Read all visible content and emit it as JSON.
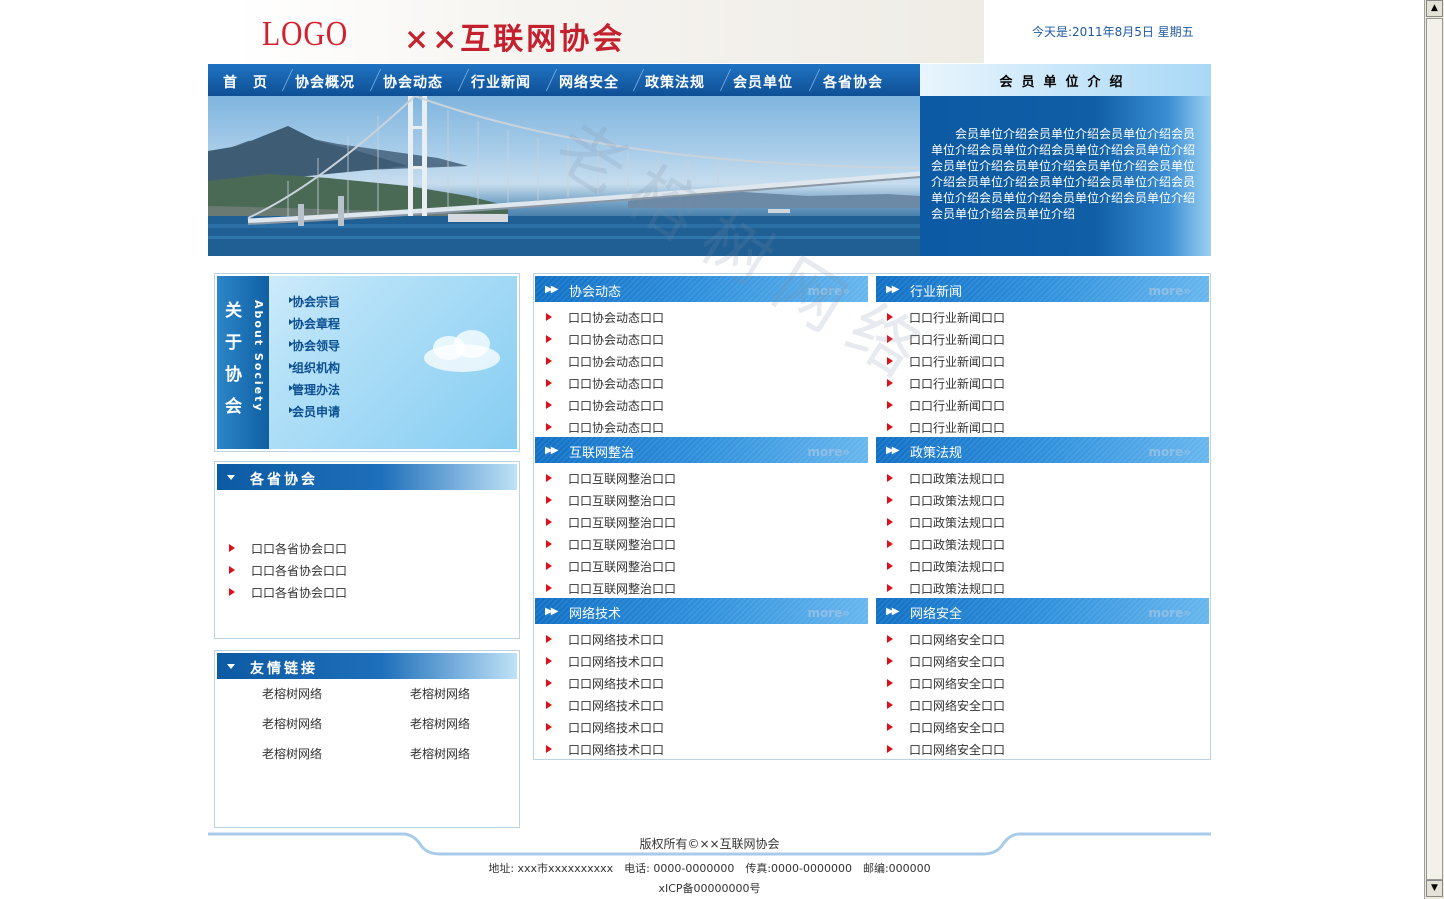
{
  "header": {
    "logo": "LOGO",
    "org_title": "××互联网协会",
    "date": "今天是:2011年8月5日 星期五"
  },
  "nav": [
    "首　页",
    "协会概况",
    "协会动态",
    "行业新闻",
    "网络安全",
    "政策法规",
    "会员单位",
    "各省协会"
  ],
  "member": {
    "title": "会员单位介绍",
    "text": "会员单位介绍会员单位介绍会员单位介绍会员单位介绍会员单位介绍会员单位介绍会员单位介绍会员单位介绍会员单位介绍会员单位介绍会员单位介绍会员单位介绍会员单位介绍会员单位介绍会员单位介绍会员单位介绍会员单位介绍会员单位介绍会员单位介绍会员单位介绍"
  },
  "about": {
    "title_cn": [
      "关",
      "于",
      "协",
      "会"
    ],
    "title_en": "About Society",
    "links": [
      "协会宗旨",
      "协会章程",
      "协会领导",
      "组织机构",
      "管理办法",
      "会员申请"
    ]
  },
  "provinces": {
    "title": "各省协会",
    "items": [
      "口口各省协会口口",
      "口口各省协会口口",
      "口口各省协会口口"
    ]
  },
  "friends": {
    "title": "友情链接",
    "links": [
      "老榕树网络",
      "老榕树网络",
      "老榕树网络",
      "老榕树网络",
      "老榕树网络",
      "老榕树网络"
    ]
  },
  "sections": [
    {
      "title": "协会动态",
      "more": "more»",
      "items": [
        "口口协会动态口口",
        "口口协会动态口口",
        "口口协会动态口口",
        "口口协会动态口口",
        "口口协会动态口口",
        "口口协会动态口口"
      ]
    },
    {
      "title": "行业新闻",
      "more": "more»",
      "items": [
        "口口行业新闻口口",
        "口口行业新闻口口",
        "口口行业新闻口口",
        "口口行业新闻口口",
        "口口行业新闻口口",
        "口口行业新闻口口"
      ]
    },
    {
      "title": "互联网整治",
      "more": "more»",
      "items": [
        "口口互联网整治口口",
        "口口互联网整治口口",
        "口口互联网整治口口",
        "口口互联网整治口口",
        "口口互联网整治口口",
        "口口互联网整治口口"
      ]
    },
    {
      "title": "政策法规",
      "more": "more»",
      "items": [
        "口口政策法规口口",
        "口口政策法规口口",
        "口口政策法规口口",
        "口口政策法规口口",
        "口口政策法规口口",
        "口口政策法规口口"
      ]
    },
    {
      "title": "网络技术",
      "more": "more»",
      "items": [
        "口口网络技术口口",
        "口口网络技术口口",
        "口口网络技术口口",
        "口口网络技术口口",
        "口口网络技术口口",
        "口口网络技术口口"
      ]
    },
    {
      "title": "网络安全",
      "more": "more»",
      "items": [
        "口口网络安全口口",
        "口口网络安全口口",
        "口口网络安全口口",
        "口口网络安全口口",
        "口口网络安全口口",
        "口口网络安全口口"
      ]
    }
  ],
  "footer": {
    "copyright": "版权所有©××互联网协会",
    "address": "地址: xxx市xxxxxxxxxx　电话: 0000-0000000　传真:0000-0000000　邮编:000000",
    "icp": "xICP备00000000号"
  },
  "watermark": "老榕树网络",
  "colors": {
    "nav_blue": "#0f4f95",
    "accent_red": "#c4202e",
    "link_blue": "#0b4f91"
  }
}
